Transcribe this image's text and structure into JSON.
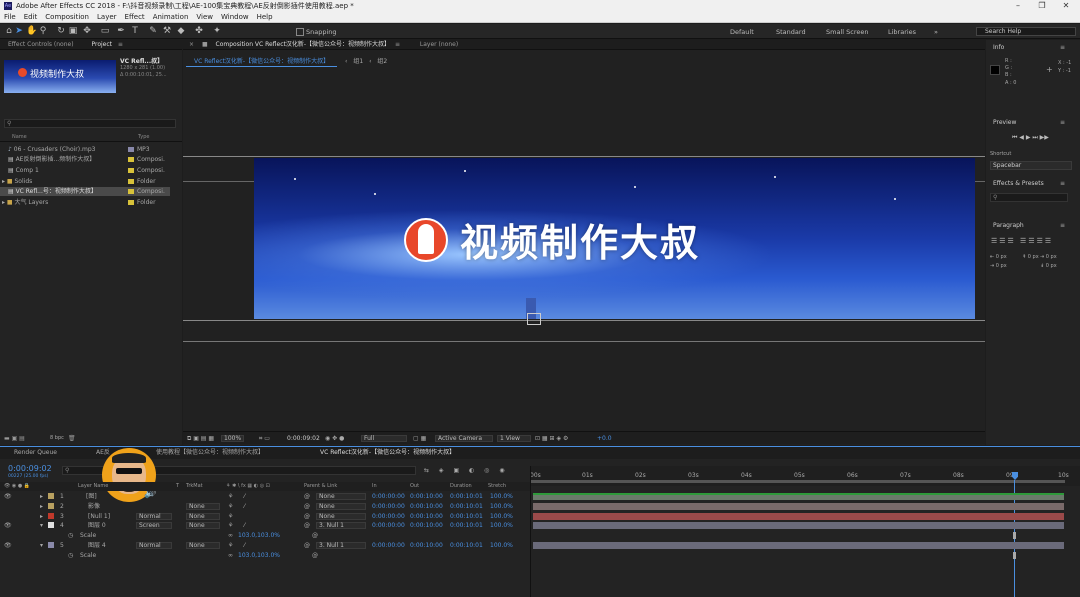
{
  "app": {
    "title": "Adobe After Effects CC 2018 - F:\\抖音视频录制\\工程\\AE-100集宝典教程\\AE反射倒影插件使用教程.aep *",
    "min": "–",
    "max": "❐",
    "close": "✕"
  },
  "menu": [
    "File",
    "Edit",
    "Composition",
    "Layer",
    "Effect",
    "Animation",
    "View",
    "Window",
    "Help"
  ],
  "toolbar": {
    "snapping": "Snapping",
    "workspaces": [
      "Default",
      "Standard",
      "Small Screen",
      "Libraries"
    ],
    "more": "»",
    "search_placeholder": "Search Help"
  },
  "left_panel": {
    "tab_effect": "Effect Controls (none)",
    "tab_project": "Project",
    "thumb_name": "VC Refl...叔】",
    "thumb_info1": "1280 x 281 (1.00)",
    "thumb_info2": "Δ 0:00:10:01, 25...",
    "thumb_text": "视频制作大叔",
    "col_name": "Name",
    "col_type": "Type",
    "items": [
      {
        "name": "06 - Crusaders (Choir).mp3",
        "type": "MP3",
        "color": "#8888aa"
      },
      {
        "name": "AE反射倒影插...频制作大叔】",
        "type": "Composi.",
        "color": "#d8c23a"
      },
      {
        "name": "Comp 1",
        "type": "Composi.",
        "color": "#d8c23a"
      },
      {
        "name": "Solids",
        "type": "Folder",
        "color": "#d8c23a"
      },
      {
        "name": "VC Refl...号：视频制作大叔】",
        "type": "Composi.",
        "color": "#d8c23a"
      },
      {
        "name": "大气 Layers",
        "type": "Folder",
        "color": "#d8c23a"
      }
    ],
    "bpc": "8 bpc"
  },
  "comp_panel": {
    "tab_comp": "Composition VC Reflect汉化新-【微信公众号：视频制作大叔】",
    "tab_layer": "Layer (none)",
    "breadcrumbs": [
      "VC Reflect汉化新-【微信公众号：视频制作大叔】",
      "组1",
      "组2"
    ],
    "banner_text": "视频制作大叔",
    "zoom": "100%",
    "timecode": "0:00:09:02",
    "resolution": "Full",
    "camera": "Active Camera",
    "views": "1 View",
    "exposure": "+0.0"
  },
  "right_panel": {
    "info_title": "Info",
    "info_rgb": [
      "R :",
      "G :",
      "B :",
      "A : 0"
    ],
    "info_xy": [
      "X : -1",
      "Y : -1"
    ],
    "preview_title": "Preview",
    "shortcut_label": "Shortcut",
    "shortcut_value": "Spacebar",
    "effects_title": "Effects & Presets",
    "paragraph_title": "Paragraph",
    "px_values": [
      "0 px",
      "0 px",
      "0 px",
      "0 px",
      "0 px"
    ]
  },
  "timeline": {
    "tabs": [
      "Render Queue",
      "AE反",
      "使用教程【微信公众号：视频制作大叔】",
      "VC Reflect汉化新-【微信公众号：视频制作大叔】"
    ],
    "timecode": "0:00:09:02",
    "frames": "00227 (25.00 fps)",
    "col_headers": {
      "layer_name": "Layer Name",
      "t": "T",
      "trkmat": "TrkMat",
      "parent": "Parent & Link",
      "in": "In",
      "out": "Out",
      "duration": "Duration",
      "stretch": "Stretch"
    },
    "ruler": [
      "00s",
      "01s",
      "02s",
      "03s",
      "04s",
      "05s",
      "06s",
      "07s",
      "08s",
      "09s",
      "10s"
    ],
    "layers": [
      {
        "num": "1",
        "name": "[图]",
        "mode": "",
        "trkmat": "",
        "parent": "None",
        "in": "0:00:00:00",
        "out": "0:00:10:00",
        "dur": "0:00:10:01",
        "stretch": "100.0%",
        "color": "#b8a060",
        "bar": "#6a7a6a"
      },
      {
        "num": "2",
        "name": "影像",
        "mode": "",
        "trkmat": "None",
        "parent": "None",
        "in": "0:00:00:00",
        "out": "0:00:10:00",
        "dur": "0:00:10:01",
        "stretch": "100.0%",
        "color": "#b8a060",
        "bar": "#7a6a6a"
      },
      {
        "num": "3",
        "name": "[Null 1]",
        "mode": "Normal",
        "trkmat": "None",
        "parent": "None",
        "in": "0:00:00:00",
        "out": "0:00:10:00",
        "dur": "0:00:10:01",
        "stretch": "100.0%",
        "color": "#c0392b",
        "bar": "#9a4a4a"
      },
      {
        "num": "4",
        "name": "图层 0",
        "mode": "Screen",
        "trkmat": "None",
        "parent": "3. Null 1",
        "in": "0:00:00:00",
        "out": "0:00:10:00",
        "dur": "0:00:10:01",
        "stretch": "100.0%",
        "color": "#e0e0e0",
        "bar": "#6a6a7a"
      },
      {
        "num": "5",
        "name": "图层 4",
        "mode": "Normal",
        "trkmat": "None",
        "parent": "3. Null 1",
        "in": "0:00:00:00",
        "out": "0:00:10:00",
        "dur": "0:00:10:01",
        "stretch": "100.0%",
        "color": "#8a8aaa",
        "bar": "#6a6a7a"
      }
    ],
    "scale_label": "Scale",
    "scale_value": "103.0,103.0%",
    "none_label": "None"
  },
  "colors": {
    "accent": "#4a8fe0",
    "bg": "#1d1d1d",
    "panel": "#232323",
    "banner_top": "#0a1a6a",
    "banner_bottom": "#6a9ae0"
  }
}
